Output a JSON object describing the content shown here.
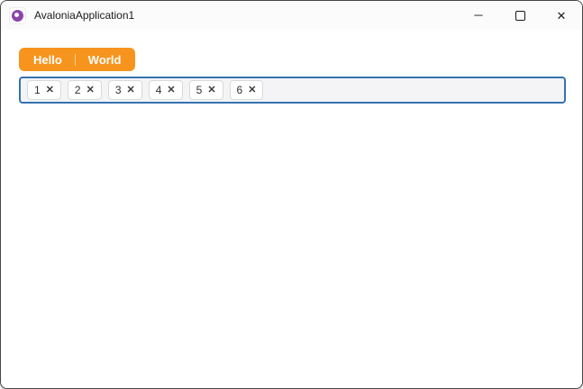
{
  "window": {
    "title": "AvaloniaApplication1",
    "caption": {
      "minimize_glyph": "─",
      "maximize_icon": "square-outline",
      "close_glyph": "✕"
    },
    "app_icon": "avalonia-logo"
  },
  "tabstrip": {
    "tabs": [
      {
        "label": "Hello"
      },
      {
        "label": "World"
      }
    ]
  },
  "tag_input": {
    "chips": [
      {
        "label": "1"
      },
      {
        "label": "2"
      },
      {
        "label": "3"
      },
      {
        "label": "4"
      },
      {
        "label": "5"
      },
      {
        "label": "6"
      }
    ],
    "remove_glyph": "✕"
  },
  "colors": {
    "accent_orange": "#F7941D",
    "focus_border_blue": "#3573B1",
    "logo_purple": "#8B44AC"
  }
}
